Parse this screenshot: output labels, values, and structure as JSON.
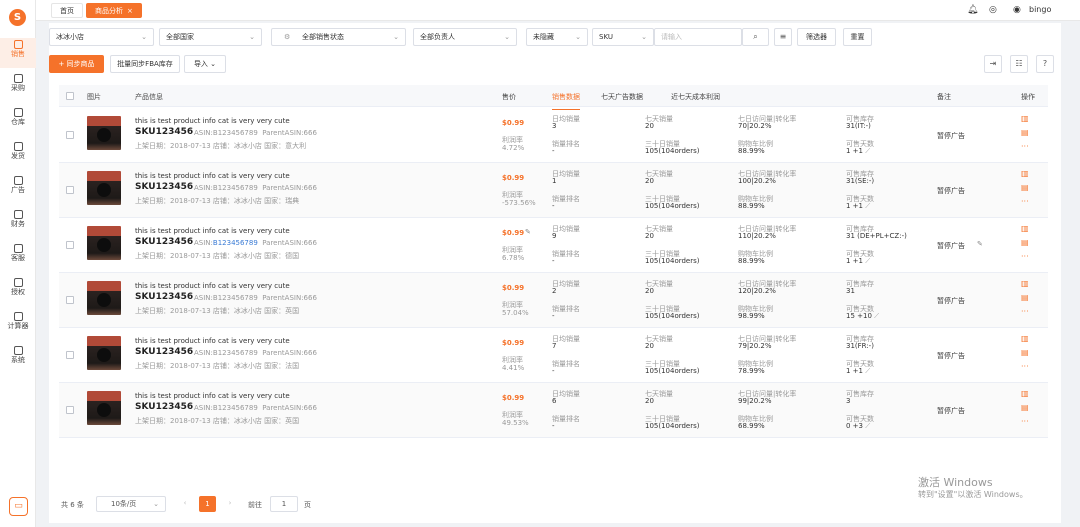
{
  "sidebar": {
    "logo": "S",
    "items": [
      {
        "label": "销售"
      },
      {
        "label": "采购"
      },
      {
        "label": "仓库"
      },
      {
        "label": "发货"
      },
      {
        "label": "广告"
      },
      {
        "label": "财务"
      },
      {
        "label": "客服"
      },
      {
        "label": "授权"
      },
      {
        "label": "计算器"
      },
      {
        "label": "系统"
      }
    ]
  },
  "topbar": {
    "tabs": [
      {
        "label": "首页"
      },
      {
        "label": "商品分析",
        "close": "×"
      }
    ],
    "username": "bingo"
  },
  "filters": {
    "shop": "冰冰小店",
    "country": "全部国家",
    "sales_status": "全部销售状态",
    "owner": "全部负责人",
    "hidden": "未隐藏",
    "search_type": "SKU",
    "search_placeholder": "请输入",
    "filter_btn": "筛选器",
    "reset_btn": "重置"
  },
  "actions": {
    "sync": "+ 同步商品",
    "fba": "批量同步FBA库存",
    "import": "导入"
  },
  "table": {
    "headers": {
      "image": "图片",
      "product": "产品信息",
      "price": "售价",
      "sales": "销售数据",
      "ads7": "七天广告数据",
      "profit7": "近七天成本利润",
      "remark": "备注",
      "ops": "操作"
    },
    "labels": {
      "margin": "利润率",
      "daily_sales": "日均销量",
      "rank": "销量排名",
      "sales7": "七天销量",
      "sales30": "三十日销量",
      "visit_conv": "七日访问量|转化率",
      "cart_ratio": "购物车比例",
      "stock": "可售库存",
      "stock_days": "可售天数"
    },
    "rows": [
      {
        "title": "this is test product info cat is very very cute",
        "sku": "SKU123456",
        "asin_prefix": "ASIN:",
        "asin": "B123456789",
        "parent": "ParentASIN:666",
        "meta": "上架日期：2018-07-13    店铺：冰冰小店    国家：意大利",
        "price": "$0.99",
        "margin": "4.72%",
        "daily": "3",
        "rank": "-",
        "s7": "20",
        "s30": "105(104orders)",
        "visit": "70|20.2%",
        "cart": "88.99%",
        "stock": "31(IT:-)",
        "days": "1 +1",
        "remark": "暂停广告"
      },
      {
        "title": "this is test product info cat is very very cute",
        "sku": "SKU123456",
        "asin_prefix": "ASIN:",
        "asin": "B123456789",
        "parent": "ParentASIN:666",
        "meta": "上架日期：2018-07-13    店铺：冰冰小店    国家：瑞典",
        "price": "$0.99",
        "margin": "-573.56%",
        "daily": "1",
        "rank": "-",
        "s7": "20",
        "s30": "105(104orders)",
        "visit": "100|20.2%",
        "cart": "88.99%",
        "stock": "31(SE:-)",
        "days": "1 +1",
        "remark": "暂停广告"
      },
      {
        "title": "this is test product info cat is very very cute",
        "sku": "SKU123456",
        "asin_prefix": "ASIN:",
        "asin": "B123456789",
        "parent": "ParentASIN:666",
        "meta": "上架日期：2018-07-13    店铺：冰冰小店    国家：德国",
        "price": "$0.99",
        "margin": "6.78%",
        "daily": "9",
        "rank": "-",
        "s7": "20",
        "s30": "105(104orders)",
        "visit": "110|20.2%",
        "cart": "88.99%",
        "stock": "31 (DE+PL+CZ:-)",
        "days": "1 +1",
        "remark": "暂停广告"
      },
      {
        "title": "this is test product info cat is very very cute",
        "sku": "SKU123456",
        "asin_prefix": "ASIN:",
        "asin": "B123456789",
        "parent": "ParentASIN:666",
        "meta": "上架日期：2018-07-13    店铺：冰冰小店    国家：英国",
        "price": "$0.99",
        "margin": "57.04%",
        "daily": "2",
        "rank": "-",
        "s7": "20",
        "s30": "105(104orders)",
        "visit": "120|20.2%",
        "cart": "98.99%",
        "stock": "31",
        "days": "15 +10",
        "remark": "暂停广告"
      },
      {
        "title": "this is test product info cat is very very cute",
        "sku": "SKU123456",
        "asin_prefix": "ASIN:",
        "asin": "B123456789",
        "parent": "ParentASIN:666",
        "meta": "上架日期：2018-07-13    店铺：冰冰小店    国家：法国",
        "price": "$0.99",
        "margin": "4.41%",
        "daily": "7",
        "rank": "-",
        "s7": "20",
        "s30": "105(104orders)",
        "visit": "79|20.2%",
        "cart": "78.99%",
        "stock": "31(FR:-)",
        "days": "1 +1",
        "remark": "暂停广告"
      },
      {
        "title": "this is test product info cat is very very cute",
        "sku": "SKU123456",
        "asin_prefix": "ASIN:",
        "asin": "B123456789",
        "parent": "ParentASIN:666",
        "meta": "上架日期：2018-07-13    店铺：冰冰小店    国家：英国",
        "price": "$0.99",
        "margin": "49.53%",
        "daily": "6",
        "rank": "-",
        "s7": "20",
        "s30": "105(104orders)",
        "visit": "99|20.2%",
        "cart": "68.99%",
        "stock": "3",
        "days": "0 +3",
        "remark": "暂停广告"
      }
    ]
  },
  "pagination": {
    "total": "共 6 条",
    "page_size": "10条/页",
    "current": "1",
    "goto_label": "前往",
    "goto_value": "1",
    "page_suffix": "页"
  },
  "watermark": {
    "line1": "激活 Windows",
    "line2": "转到\"设置\"以激活 Windows。"
  },
  "colors": {
    "accent": "#f5722a",
    "link": "#3a7bd5"
  }
}
